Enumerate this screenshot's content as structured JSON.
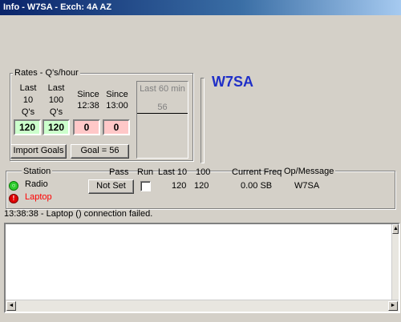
{
  "window": {
    "title": "Info - W7SA - Exch:  4A AZ"
  },
  "rates": {
    "group_label": "Rates - Q's/hour",
    "col1": {
      "line1": "Last",
      "line2": "10",
      "line3": "Q's",
      "value": "120"
    },
    "col2": {
      "line1": "Last",
      "line2": "100",
      "line3": "Q's",
      "value": "120"
    },
    "col3": {
      "line1": "Since",
      "line2": "12:38",
      "value": "0"
    },
    "col4": {
      "line1": "Since",
      "line2": "13:00",
      "value": "0"
    },
    "last60": {
      "label": "Last 60 min",
      "value": "56"
    },
    "import_goals_label": "Import Goals",
    "goal_label": "Goal = 56",
    "colors": {
      "green": "#ccffcc",
      "pink": "#ffc8c8"
    }
  },
  "callsign": {
    "text": "W7SA",
    "color": "#1f2fc8"
  },
  "stations": {
    "headers": {
      "station": "Station",
      "pass": "Pass",
      "run": "Run",
      "last10": "Last 10",
      "col100": "100",
      "freq": "Current Freq",
      "op": "Op/Message"
    },
    "pass_button_label": "Not Set",
    "rows": [
      {
        "name": "Radio",
        "status": "ok",
        "icon": "status-ok-icon",
        "last10": "120",
        "col100": "120",
        "freq": "0.00 SB",
        "op": "W7SA"
      },
      {
        "name": "Laptop",
        "status": "error",
        "icon": "status-error-icon",
        "color": "#ff0000"
      }
    ],
    "run_checked": false
  },
  "status_line": "13:38:38 - Laptop () connection failed."
}
